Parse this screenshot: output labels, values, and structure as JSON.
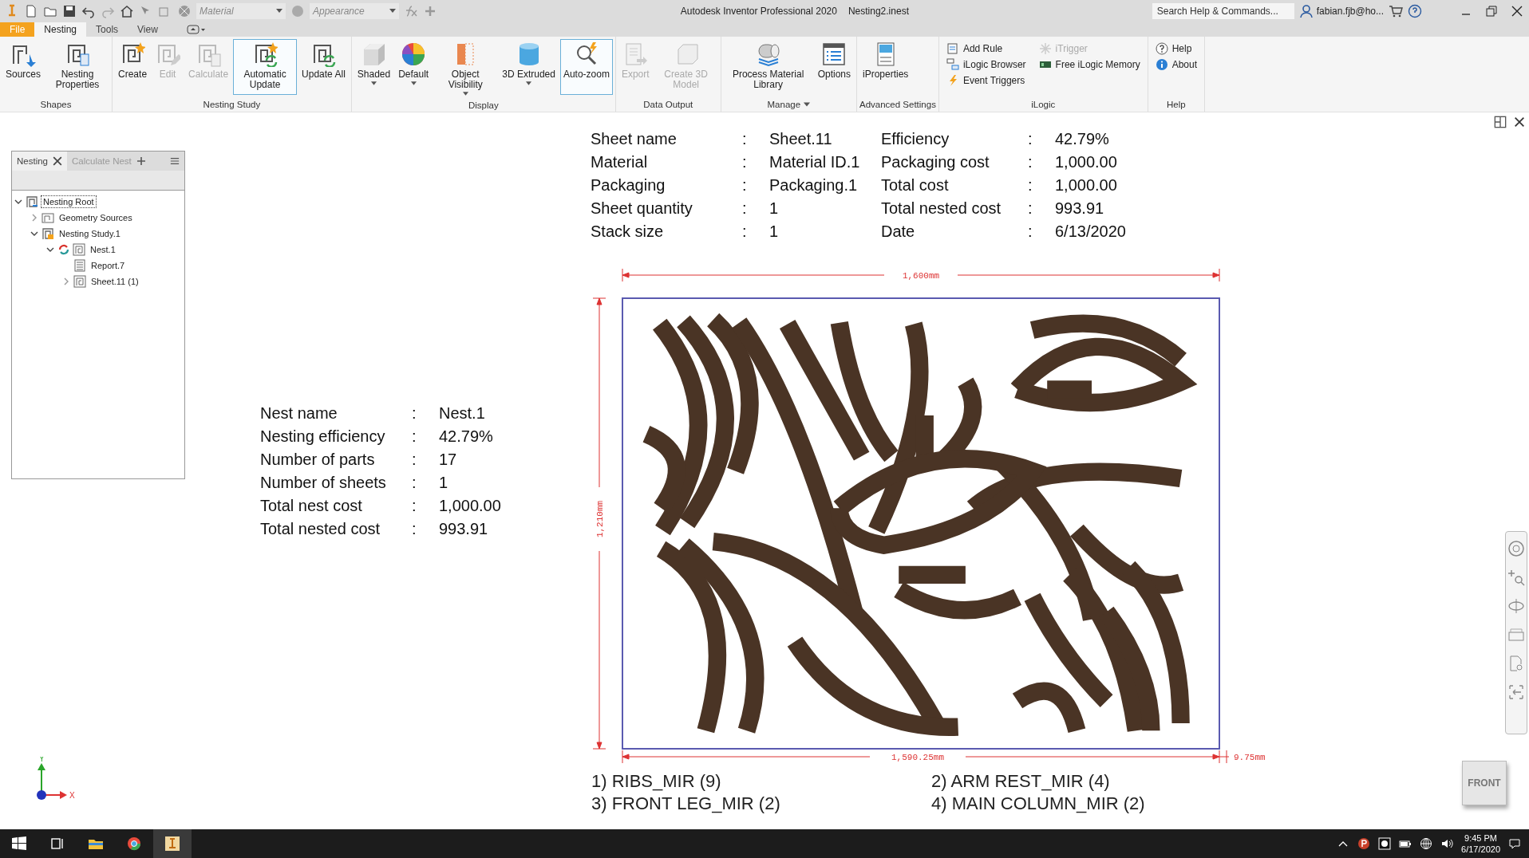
{
  "quick_access": {
    "material": "Material",
    "appearance": "Appearance"
  },
  "window": {
    "title": "Autodesk Inventor Professional 2020",
    "document": "Nesting2.inest"
  },
  "search": {
    "placeholder": "Search Help & Commands..."
  },
  "user": "fabian.fjb@ho...",
  "menu_tabs": [
    {
      "label": "File",
      "kind": "file",
      "selected": false
    },
    {
      "label": "Nesting",
      "kind": "tab",
      "selected": true
    },
    {
      "label": "Tools",
      "kind": "tab",
      "selected": false
    },
    {
      "label": "View",
      "kind": "tab",
      "selected": false
    }
  ],
  "ribbon_panels": [
    {
      "title": "Shapes",
      "menu": false,
      "buttons": [
        {
          "label": "Sources",
          "kind": "large",
          "disabled": false,
          "selected": false,
          "dropdown": false
        },
        {
          "label": "Nesting Properties",
          "kind": "large",
          "disabled": false,
          "selected": false,
          "dropdown": false
        }
      ]
    },
    {
      "title": "Nesting Study",
      "menu": false,
      "buttons": [
        {
          "label": "Create",
          "kind": "large",
          "disabled": false,
          "selected": false,
          "dropdown": false
        },
        {
          "label": "Edit",
          "kind": "large",
          "disabled": true,
          "selected": false,
          "dropdown": false
        },
        {
          "label": "Calculate",
          "kind": "large",
          "disabled": true,
          "selected": false,
          "dropdown": false
        },
        {
          "label": "Automatic Update",
          "kind": "large",
          "disabled": false,
          "selected": true,
          "dropdown": false
        },
        {
          "label": "Update All",
          "kind": "large",
          "disabled": false,
          "selected": false,
          "dropdown": false
        }
      ]
    },
    {
      "title": "Display",
      "menu": false,
      "buttons": [
        {
          "label": "Shaded",
          "kind": "large",
          "disabled": false,
          "selected": false,
          "dropdown": true
        },
        {
          "label": "Default",
          "kind": "large",
          "disabled": false,
          "selected": false,
          "dropdown": true
        },
        {
          "label": "Object Visibility",
          "kind": "large",
          "disabled": false,
          "selected": false,
          "dropdown": true
        },
        {
          "label": "3D Extruded",
          "kind": "large",
          "disabled": false,
          "selected": false,
          "dropdown": true
        },
        {
          "label": "Auto-zoom",
          "kind": "large",
          "disabled": false,
          "selected": true,
          "dropdown": false
        }
      ]
    },
    {
      "title": "Data Output",
      "menu": false,
      "buttons": [
        {
          "label": "Export",
          "kind": "large",
          "disabled": true,
          "selected": false,
          "dropdown": false
        },
        {
          "label": "Create 3D Model",
          "kind": "large",
          "disabled": true,
          "selected": false,
          "dropdown": false
        }
      ]
    },
    {
      "title": "Manage",
      "menu": true,
      "buttons": [
        {
          "label": "Process Material Library",
          "kind": "large",
          "disabled": false,
          "selected": false,
          "dropdown": false
        },
        {
          "label": "Options",
          "kind": "large",
          "disabled": false,
          "selected": false,
          "dropdown": false
        }
      ]
    },
    {
      "title": "Advanced Settings",
      "menu": false,
      "buttons": [
        {
          "label": "iProperties",
          "kind": "large",
          "disabled": false,
          "selected": false,
          "dropdown": false
        }
      ]
    },
    {
      "title": "iLogic",
      "menu": false,
      "buttons": [
        {
          "label": "Add Rule",
          "kind": "small",
          "disabled": false
        },
        {
          "label": "iLogic Browser",
          "kind": "small",
          "disabled": false
        },
        {
          "label": "Event Triggers",
          "kind": "small",
          "disabled": false
        },
        {
          "label": "iTrigger",
          "kind": "small",
          "disabled": true
        },
        {
          "label": "Free iLogic Memory",
          "kind": "small",
          "disabled": false
        }
      ]
    },
    {
      "title": "Help",
      "menu": false,
      "buttons": [
        {
          "label": "Help",
          "kind": "small",
          "disabled": false
        },
        {
          "label": "About",
          "kind": "small",
          "disabled": false
        }
      ]
    }
  ],
  "browser": {
    "tabs": [
      {
        "label": "Nesting",
        "selected": true
      },
      {
        "label": "Calculate Nest",
        "selected": false
      }
    ],
    "tree": [
      {
        "label": "Nesting Root",
        "kind": "root",
        "selected": true,
        "needs_update": false,
        "expanded": true,
        "children": [
          {
            "label": "Geometry Sources",
            "kind": "folder",
            "selected": false,
            "needs_update": false,
            "expanded": false
          },
          {
            "label": "Nesting Study.1",
            "kind": "study",
            "selected": false,
            "needs_update": false,
            "expanded": true,
            "children": [
              {
                "label": "Nest.1",
                "kind": "nest",
                "selected": false,
                "needs_update": true,
                "expanded": true,
                "children": [
                  {
                    "label": "Report.7",
                    "kind": "report",
                    "selected": false,
                    "needs_update": false
                  },
                  {
                    "label": "Sheet.11 (1)",
                    "kind": "nest",
                    "selected": false,
                    "needs_update": false,
                    "expanded": false
                  }
                ]
              }
            ]
          }
        ]
      }
    ]
  },
  "sheet_info": {
    "left": [
      {
        "label": "Sheet name",
        "value": "Sheet.11"
      },
      {
        "label": "Material",
        "value": "Material ID.1"
      },
      {
        "label": "Packaging",
        "value": "Packaging.1"
      },
      {
        "label": "Sheet quantity",
        "value": "1"
      },
      {
        "label": "Stack size",
        "value": "1"
      }
    ],
    "right": [
      {
        "label": "Efficiency",
        "value": "42.79%"
      },
      {
        "label": "Packaging cost",
        "value": "1,000.00"
      },
      {
        "label": "Total cost",
        "value": "1,000.00"
      },
      {
        "label": "Total nested cost",
        "value": "993.91"
      },
      {
        "label": "Date",
        "value": "6/13/2020"
      }
    ],
    "separator": ":"
  },
  "nest_info": [
    {
      "label": "Nest name",
      "value": "Nest.1"
    },
    {
      "label": "Nesting efficiency",
      "value": "42.79%"
    },
    {
      "label": "Number of parts",
      "value": "17"
    },
    {
      "label": "Number of sheets",
      "value": "1"
    },
    {
      "label": "Total nest cost",
      "value": "1,000.00"
    },
    {
      "label": "Total nested cost",
      "value": "993.91"
    }
  ],
  "dimensions": {
    "width": "1,600mm",
    "height": "1,210mm",
    "used_width": "1,590.25mm",
    "remainder": "9.75mm"
  },
  "legend": [
    "1) RIBS_MIR (9)",
    "2) ARM REST_MIR (4)",
    "3) FRONT LEG_MIR (2)",
    "4) MAIN COLUMN_MIR (2)"
  ],
  "view_cube": "FRONT",
  "axes": {
    "x": "X",
    "y": "Y"
  },
  "taskbar": {
    "time": "9:45 PM",
    "date": "6/17/2020"
  }
}
